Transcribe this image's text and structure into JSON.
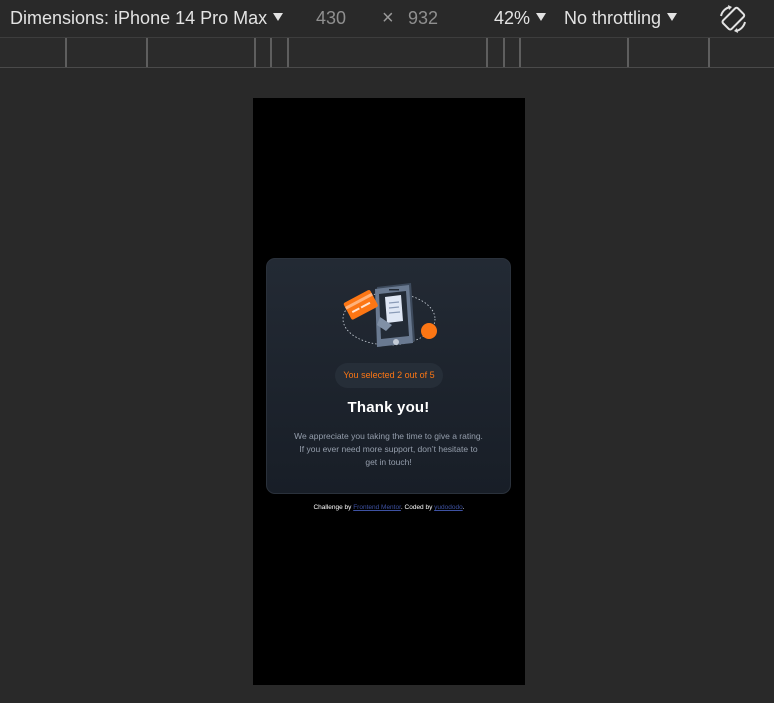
{
  "toolbar": {
    "dimensions_label": "Dimensions: iPhone 14 Pro Max",
    "width_value": "430",
    "times_symbol": "×",
    "height_value": "932",
    "zoom": "42%",
    "throttling": "No throttling",
    "rotate_icon": "rotate-icon"
  },
  "card": {
    "illustration_icon": "phone-payment-illustration",
    "selected_text": "You selected 2 out of 5",
    "title": "Thank you!",
    "description": "We appreciate you taking the time to give a rating. If you ever need more support, don’t hesitate to get in touch!"
  },
  "attribution": {
    "prefix": "Challenge by ",
    "link1": "Frontend Mentor",
    "middle": ". Coded by ",
    "link2": "yudododo",
    "suffix": "."
  },
  "colors": {
    "accent": "#fc7614",
    "card_bg": "#1e252e",
    "link": "#3e52a3"
  }
}
